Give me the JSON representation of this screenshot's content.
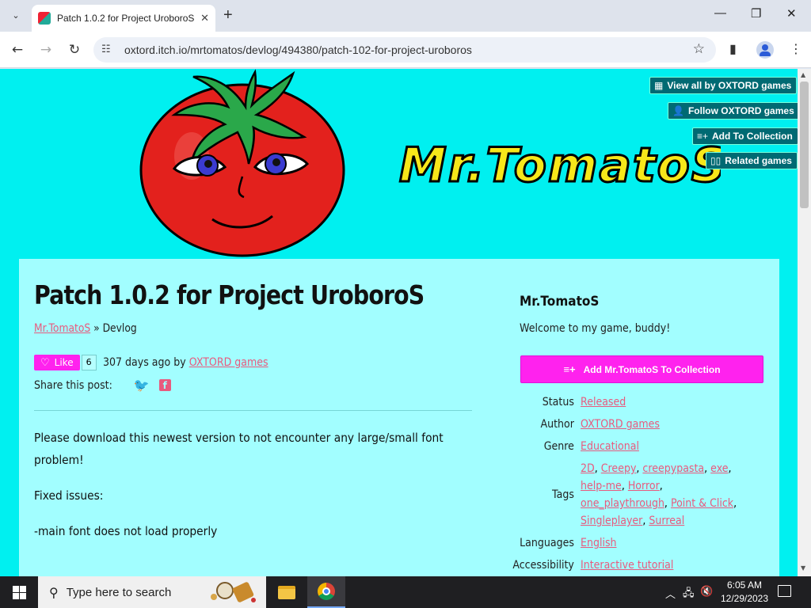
{
  "browser": {
    "tab_title": "Patch 1.0.2 for Project UroboroS",
    "url": "oxtord.itch.io/mrtomatos/devlog/494380/patch-102-for-project-uroboros",
    "new_tab": "+",
    "minimize": "—",
    "maximize": "❐",
    "close": "✕"
  },
  "header": {
    "game_name": "Mr.TomatoS",
    "buttons": [
      {
        "label": "View all by OXTORD games",
        "icon": "store-icon"
      },
      {
        "label": "Follow OXTORD games",
        "icon": "add-user-icon"
      },
      {
        "label": "Add To Collection",
        "icon": "add-list-icon"
      },
      {
        "label": "Related games",
        "icon": "map-icon"
      }
    ]
  },
  "post": {
    "title": "Patch 1.0.2 for Project UroboroS",
    "breadcrumb_game": "Mr.TomatoS",
    "breadcrumb_sep": " » ",
    "breadcrumb_section": "Devlog",
    "like_label": "Like",
    "like_count": "6",
    "posted_prefix": "307 days ago by ",
    "author": "OXTORD games",
    "share_label": "Share this post:",
    "paragraphs": [
      "Please download this newest version to not encounter any large/small font problem!",
      "Fixed issues:",
      "-main font does not load properly"
    ]
  },
  "sidebar": {
    "title": "Mr.TomatoS",
    "description": "Welcome to my game, buddy!",
    "collection_button": "Add Mr.TomatoS To Collection",
    "info": {
      "status_label": "Status",
      "status_value": "Released",
      "author_label": "Author",
      "author_value": "OXTORD games",
      "genre_label": "Genre",
      "genre_value": "Educational",
      "tags_label": "Tags",
      "tags": [
        "2D",
        "Creepy",
        "creepypasta",
        "exe",
        "help-me",
        "Horror",
        "one_playthrough",
        "Point & Click",
        "Singleplayer",
        "Surreal"
      ],
      "languages_label": "Languages",
      "languages_value": "English",
      "accessibility_label": "Accessibility",
      "accessibility_value": "Interactive tutorial"
    }
  },
  "taskbar": {
    "search_placeholder": "Type here to search",
    "time": "6:05 AM",
    "date": "12/29/2023"
  },
  "colors": {
    "page_bg": "#00f0f0",
    "panel_bg": "#a2feff",
    "accent_pink": "#ff22ee",
    "link": "#e85a7e",
    "header_button": "#006a73"
  }
}
